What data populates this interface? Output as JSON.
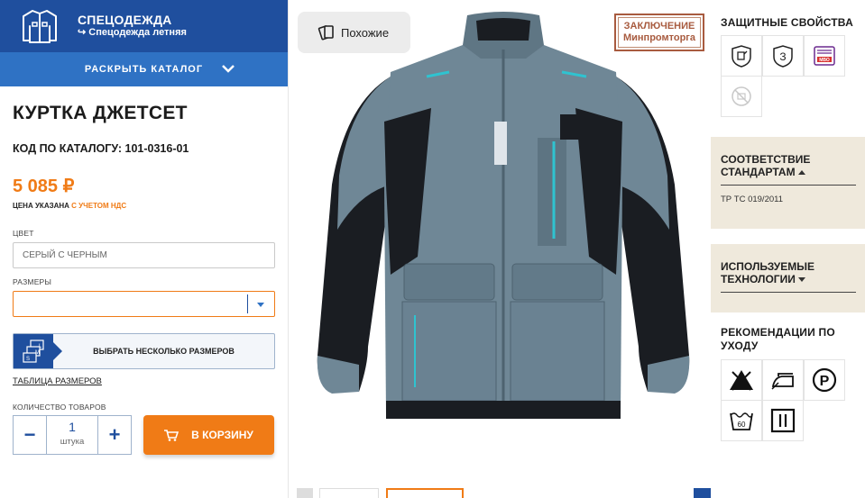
{
  "breadcrumb": {
    "category": "СПЕЦОДЕЖДА",
    "subcategory": "Спецодежда летняя"
  },
  "catalog_button": {
    "label": "РАСКРЫТЬ КАТАЛОГ"
  },
  "product": {
    "title": "КУРТКА ДЖЕТСЕТ",
    "code": "КОД ПО КАТАЛОГУ: 101-0316-01",
    "price": "5 085 ₽",
    "vat_prefix": "ЦЕНА УКАЗАНА",
    "vat_link": "С УЧЕТОМ НДС"
  },
  "color": {
    "label": "ЦВЕТ",
    "placeholder": "СЕРЫЙ С ЧЕРНЫМ"
  },
  "sizes": {
    "label": "РАЗМЕРЫ",
    "value": ""
  },
  "multi_size": {
    "label_bold": "ВЫБРАТЬ",
    "label_rest": " НЕСКОЛЬКО РАЗМЕРОВ",
    "badge_letters": [
      "L",
      "M",
      "S"
    ]
  },
  "size_table": {
    "label": "ТАБЛИЦА РАЗМЕРОВ"
  },
  "quantity": {
    "label": "КОЛИЧЕСТВО ТОВАРОВ",
    "value": "1",
    "unit": "штука",
    "minus": "−",
    "plus": "+"
  },
  "cart": {
    "label": "В КОРЗИНУ"
  },
  "similar": {
    "label": "Похожие"
  },
  "stamp": {
    "line1": "ЗАКЛЮЧЕНИЕ",
    "line2": "Минпромторга"
  },
  "protection": {
    "title": "ЗАЩИТНЫЕ СВОЙСТВА",
    "icons": [
      "oil-resistant-icon",
      "number-3-icon",
      "mvo-icon",
      "antistatic-disabled-icon"
    ],
    "icon_texts": {
      "three": "З",
      "mvo": "МВО"
    }
  },
  "standards": {
    "title": "СООТВЕТСТВИЕ СТАНДАРТАМ",
    "value": "ТР ТС 019/2011"
  },
  "technologies": {
    "title": "ИСПОЛЬЗУЕМЫЕ ТЕХНОЛОГИИ"
  },
  "care": {
    "title": "РЕКОМЕНДАЦИИ ПО УХОДУ",
    "icons": [
      "no-bleach-icon",
      "iron-icon",
      "dry-clean-p-icon",
      "wash-60-icon",
      "tumble-dry-lines-icon"
    ],
    "icon_texts": {
      "p": "P",
      "wash": "60"
    }
  },
  "colors": {
    "brand_blue": "#1f4f9e",
    "catalog_blue": "#2f72c4",
    "accent_orange": "#f07b16",
    "beige": "#efe9dc",
    "jacket_grey": "#6f8796",
    "jacket_black": "#1a1d22",
    "jacket_cyan": "#2fc3d0"
  }
}
